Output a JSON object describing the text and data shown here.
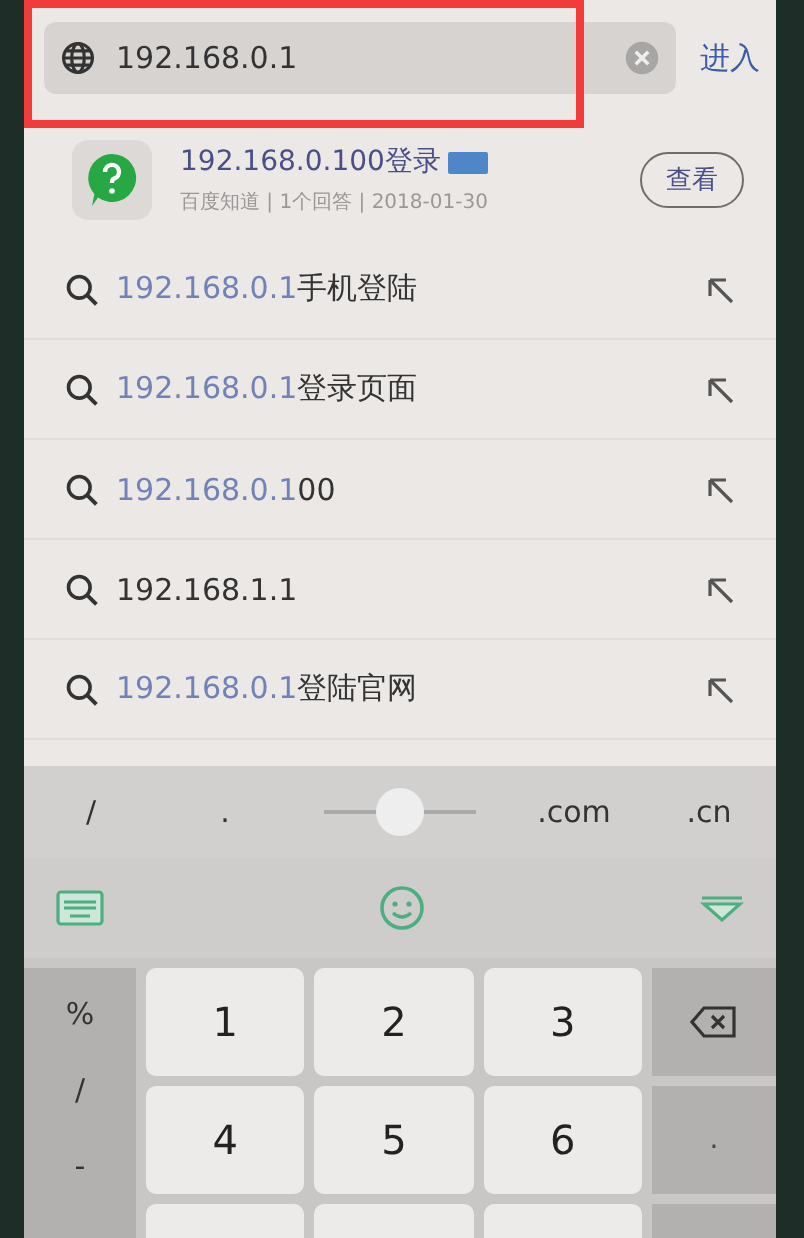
{
  "address_bar": {
    "value": "192.168.0.1",
    "go": "进入"
  },
  "top_result": {
    "title": "192.168.0.100登录",
    "meta": "百度知道 | 1个回答 | 2018-01-30",
    "button": "查看"
  },
  "suggestions": [
    {
      "match": "192.168.0.1",
      "rest": "手机登陆"
    },
    {
      "match": "192.168.0.1",
      "rest": "登录页面"
    },
    {
      "match": "192.168.0.1",
      "rest": "00"
    },
    {
      "rest": "192.168.1.1"
    },
    {
      "match": "192.168.0.1",
      "rest": "登陆官网"
    }
  ],
  "keyboard_toolbar": {
    "left": [
      "/",
      "."
    ],
    "cursor_slider": {
      "level": 0.5
    },
    "right": [
      ".com",
      ".cn"
    ]
  },
  "keypad": {
    "side_keys": [
      "%",
      "/",
      "-"
    ],
    "digits": [
      "1",
      "2",
      "3",
      "4",
      "5",
      "6"
    ],
    "right_keys": [
      {
        "kind": "backspace"
      },
      {
        "kind": "text",
        "label": "."
      }
    ]
  }
}
